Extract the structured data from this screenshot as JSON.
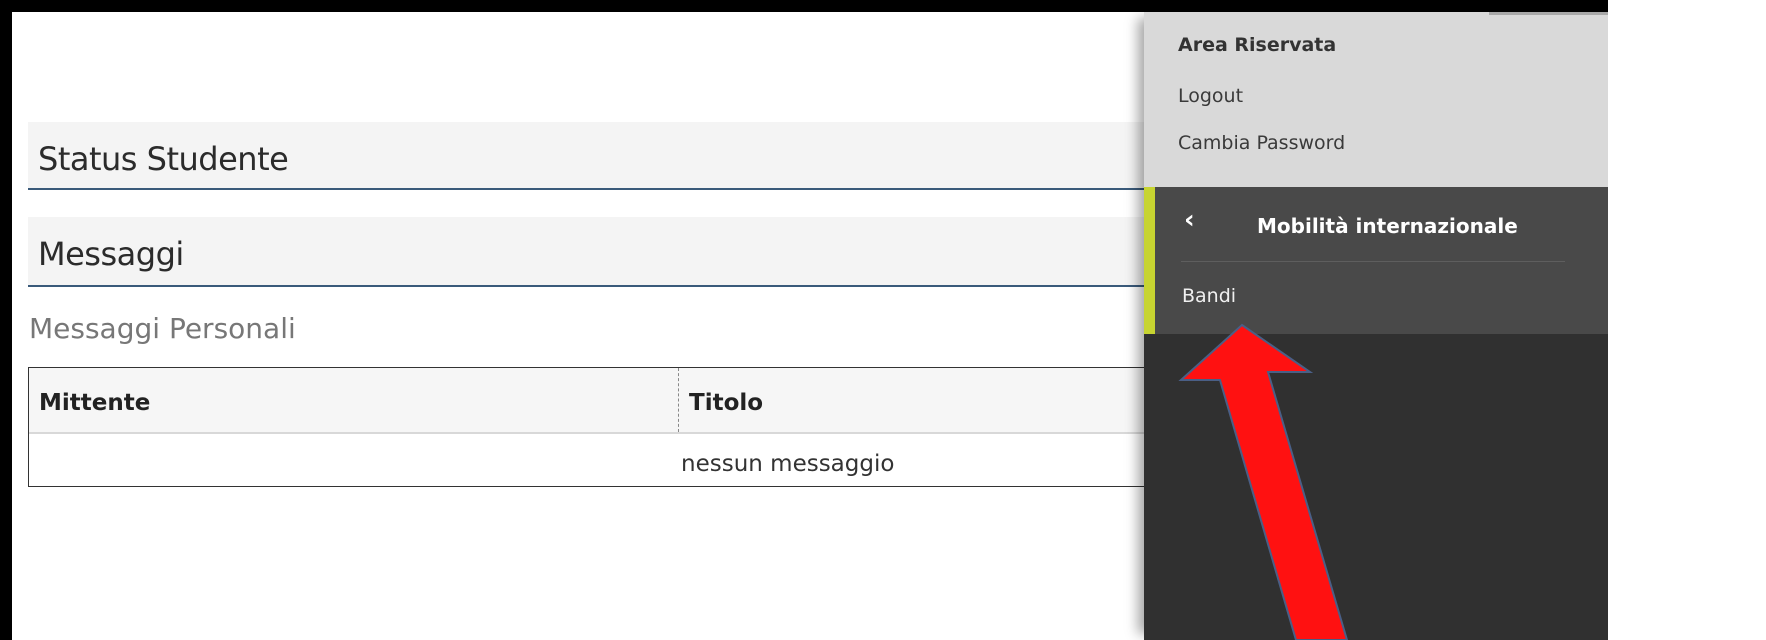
{
  "main": {
    "status_title": "Status Studente",
    "messages_title": "Messaggi",
    "personal_messages_label": "Messaggi Personali",
    "table": {
      "columns": [
        "Mittente",
        "Titolo"
      ],
      "empty_text": "nessun messaggio"
    }
  },
  "sidebar": {
    "area_title": "Area Riservata",
    "logout_label": "Logout",
    "change_password_label": "Cambia Password",
    "submenu": {
      "back_icon": "‹",
      "title": "Mobilità internazionale",
      "items": [
        "Bandi"
      ]
    }
  },
  "annotation": {
    "arrow_icon": "red-arrow-icon",
    "color": "#ff0000"
  }
}
